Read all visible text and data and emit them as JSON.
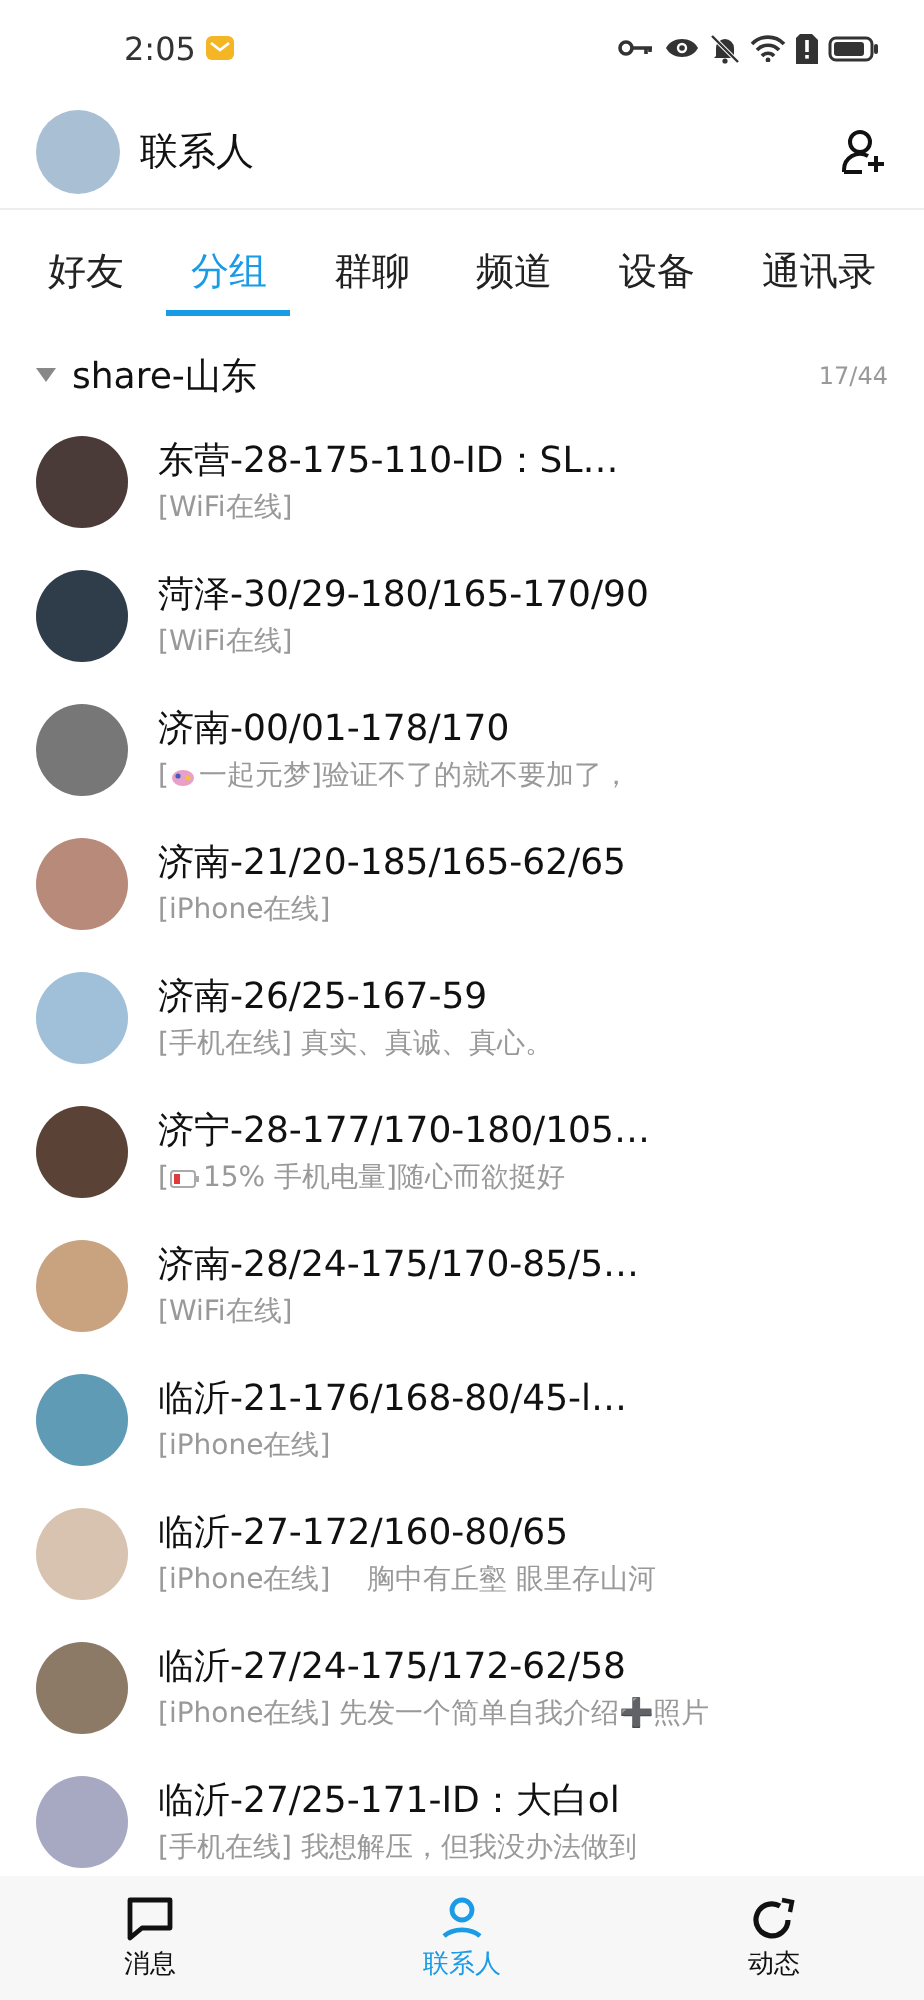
{
  "status_bar": {
    "time": "2:05"
  },
  "header": {
    "title": "联系人"
  },
  "tabs": [
    {
      "label": "好友",
      "selected": false
    },
    {
      "label": "分组",
      "selected": true
    },
    {
      "label": "群聊",
      "selected": false
    },
    {
      "label": "频道",
      "selected": false
    },
    {
      "label": "设备",
      "selected": false
    },
    {
      "label": "通讯录",
      "selected": false
    }
  ],
  "group": {
    "name": "share-山东",
    "expanded": true,
    "count": "17/44"
  },
  "contacts": [
    {
      "name": "东营-28-175-110-ID：SL…",
      "status": {
        "kind": "plain",
        "text": "[WiFi在线]"
      }
    },
    {
      "name": "菏泽-30/29-180/165-170/90",
      "status": {
        "kind": "plain",
        "text": "[WiFi在线]"
      }
    },
    {
      "name": "济南-00/01-178/170",
      "status": {
        "kind": "game",
        "lead": "[",
        "text": "一起元梦]验证不了的就不要加了，"
      }
    },
    {
      "name": "济南-21/20-185/165-62/65",
      "status": {
        "kind": "plain",
        "text": "[iPhone在线]"
      }
    },
    {
      "name": "济南-26/25-167-59",
      "status": {
        "kind": "plain",
        "text": "[手机在线] 真实、真诚、真心。"
      }
    },
    {
      "name": "济宁-28-177/170-180/105…",
      "status": {
        "kind": "battery",
        "lead": "[",
        "text": "15% 手机电量]随心而欲挺好"
      }
    },
    {
      "name": "济南-28/24-175/170-85/5…",
      "status": {
        "kind": "plain",
        "text": "[WiFi在线]"
      }
    },
    {
      "name": "临沂-21-176/168-80/45-l…",
      "status": {
        "kind": "plain",
        "text": "[iPhone在线]"
      }
    },
    {
      "name": "临沂-27-172/160-80/65",
      "status": {
        "kind": "plain",
        "text": "[iPhone在线]　 胸中有丘壑 眼里存山河"
      }
    },
    {
      "name": "临沂-27/24-175/172-62/58",
      "status": {
        "kind": "plain",
        "text": "[iPhone在线] 先发一个简单自我介绍➕照片"
      }
    },
    {
      "name": "临沂-27/25-171-ID：大白ol",
      "status": {
        "kind": "plain",
        "text": "[手机在线] 我想解压，但我没办法做到"
      }
    }
  ],
  "bottom_nav": [
    {
      "label": "消息",
      "selected": false
    },
    {
      "label": "联系人",
      "selected": true
    },
    {
      "label": "动态",
      "selected": false
    }
  ]
}
